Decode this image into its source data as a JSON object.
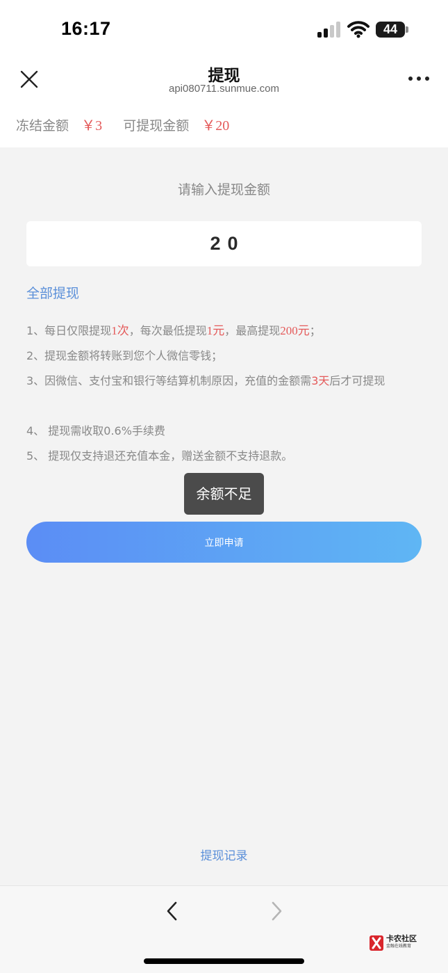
{
  "status_bar": {
    "time": "16:17",
    "battery": "44"
  },
  "nav": {
    "title": "提现",
    "url": "api080711.sunmue.com",
    "close_icon": "close-icon",
    "more_icon": "more-horizontal-icon"
  },
  "balance": {
    "frozen_label": "冻结金额",
    "frozen_amount": "￥3",
    "available_label": "可提现金额",
    "available_amount": "￥20"
  },
  "form": {
    "prompt": "请输入提现金额",
    "amount_value": "20",
    "withdraw_all": "全部提现",
    "submit_label": "立即申请"
  },
  "rules": {
    "r1_a": "1、每日仅限提现",
    "r1_b": "1次",
    "r1_c": "，每次最低提现",
    "r1_d": "1元",
    "r1_e": "，最高提现",
    "r1_f": "200元",
    "r1_g": "；",
    "r2": "2、提现金额将转账到您个人微信零钱；",
    "r3_a": "3、因微信、支付宝和银行等结算机制原因，充值的金额需",
    "r3_b": "3天",
    "r3_c": "后才可提现",
    "r4": "4、 提现需收取0.6%手续费",
    "r5": "5、 提现仅支持退还充值本金，赠送金额不支持退款。"
  },
  "toast": "余额不足",
  "records_link": "提现记录",
  "watermark": {
    "name": "卡农社区",
    "tagline": "金融在线教育"
  },
  "colors": {
    "accent_red": "#e45a5a",
    "link_blue": "#5a8fd9",
    "button_gradient_start": "#5b8df5",
    "button_gradient_end": "#5fb6f4"
  }
}
